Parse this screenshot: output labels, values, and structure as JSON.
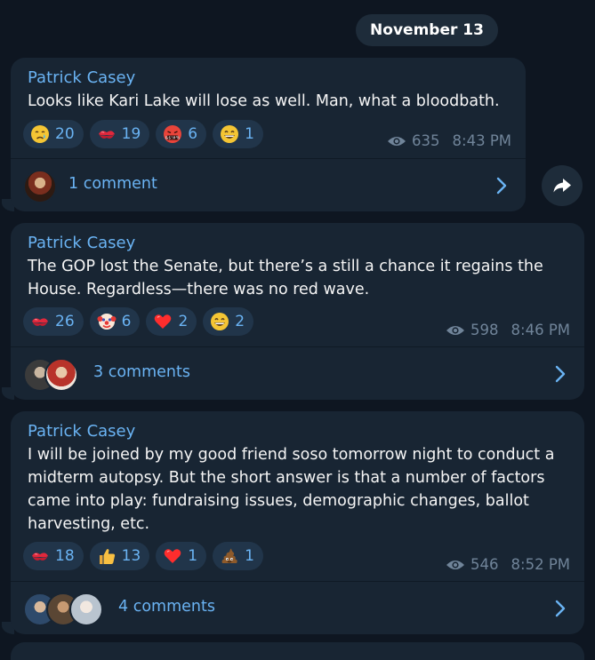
{
  "date_separator": "November 13",
  "posts": [
    {
      "author": "Patrick Casey",
      "text": "Looks like Kari Lake will lose as well. Man, what a bloodbath.",
      "reactions": [
        {
          "emoji": "crying-face-icon",
          "count": "20"
        },
        {
          "emoji": "kiss-mark-icon",
          "count": "19"
        },
        {
          "emoji": "face-with-symbols-on-mouth-icon",
          "count": "6"
        },
        {
          "emoji": "grinning-face-icon",
          "count": "1"
        }
      ],
      "views": "635",
      "time": "8:43 PM",
      "comments": "1 comment"
    },
    {
      "author": "Patrick Casey",
      "text": "The GOP lost the Senate, but there’s a still a chance it regains the House. Regardless—there was no red wave.",
      "reactions": [
        {
          "emoji": "kiss-mark-icon",
          "count": "26"
        },
        {
          "emoji": "clown-face-icon",
          "count": "6"
        },
        {
          "emoji": "red-heart-icon",
          "count": "2"
        },
        {
          "emoji": "grinning-face-icon",
          "count": "2"
        }
      ],
      "views": "598",
      "time": "8:46 PM",
      "comments": "3 comments"
    },
    {
      "author": "Patrick Casey",
      "text": "I will be joined by my good friend soso tomorrow night to conduct a midterm autopsy. But the short answer is that a number of factors came into play: fundraising issues, demographic changes, ballot harvesting, etc.",
      "reactions": [
        {
          "emoji": "kiss-mark-icon",
          "count": "18"
        },
        {
          "emoji": "thumbs-up-icon",
          "count": "13"
        },
        {
          "emoji": "red-heart-icon",
          "count": "1"
        },
        {
          "emoji": "pile-of-poo-icon",
          "count": "1"
        }
      ],
      "views": "546",
      "time": "8:52 PM",
      "comments": "4 comments"
    }
  ],
  "colors": {
    "background": "#0e1621",
    "bubble": "#182533",
    "accent": "#6ab3f3",
    "reaction_pill": "#21354a",
    "meta": "#708499"
  }
}
